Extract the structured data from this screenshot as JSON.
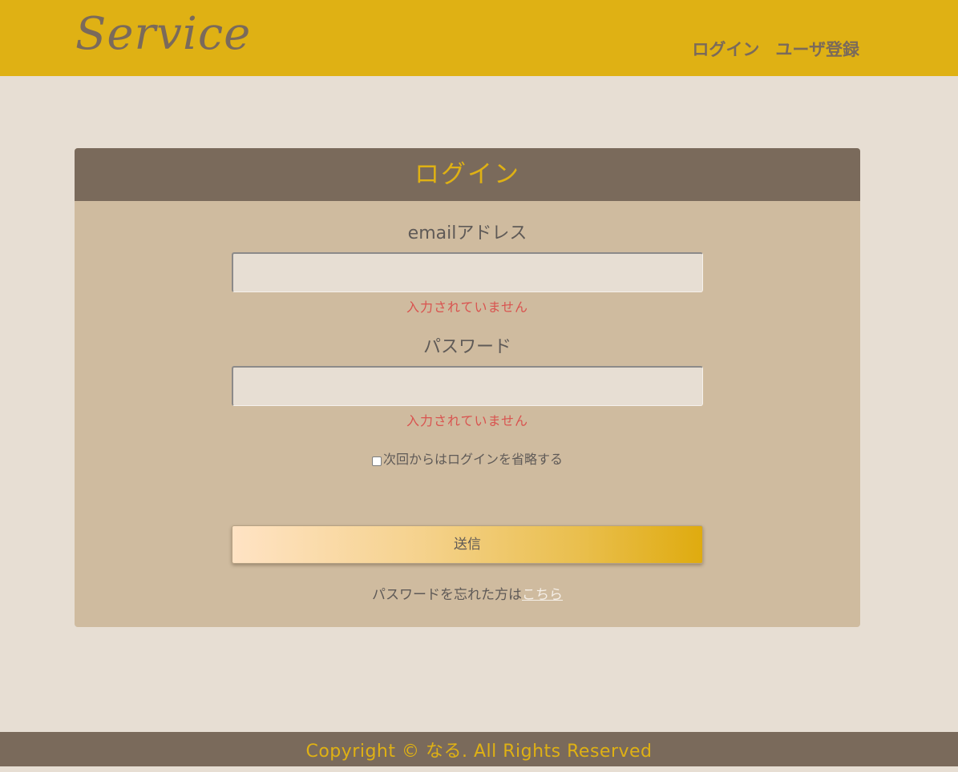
{
  "header": {
    "logo": "Service",
    "nav": {
      "login": "ログイン",
      "register": "ユーザ登録"
    }
  },
  "form": {
    "title": "ログイン",
    "email": {
      "label": "emailアドレス",
      "value": "",
      "error": "入力されていません"
    },
    "password": {
      "label": "パスワード",
      "value": "",
      "error": "入力されていません"
    },
    "remember": {
      "label": "次回からはログインを省略する",
      "checked": false
    },
    "submit_label": "送信",
    "forgot": {
      "text": "パスワードを忘れた方は",
      "link": "こちら"
    }
  },
  "footer": {
    "copyright": "Copyright © なる. All Rights Reserved"
  },
  "colors": {
    "header_bg": "#dfb114",
    "page_bg": "#e7ded3",
    "card_bg": "#cfbb9f",
    "accent_dark": "#7a6a5b",
    "error": "#d9534f"
  }
}
